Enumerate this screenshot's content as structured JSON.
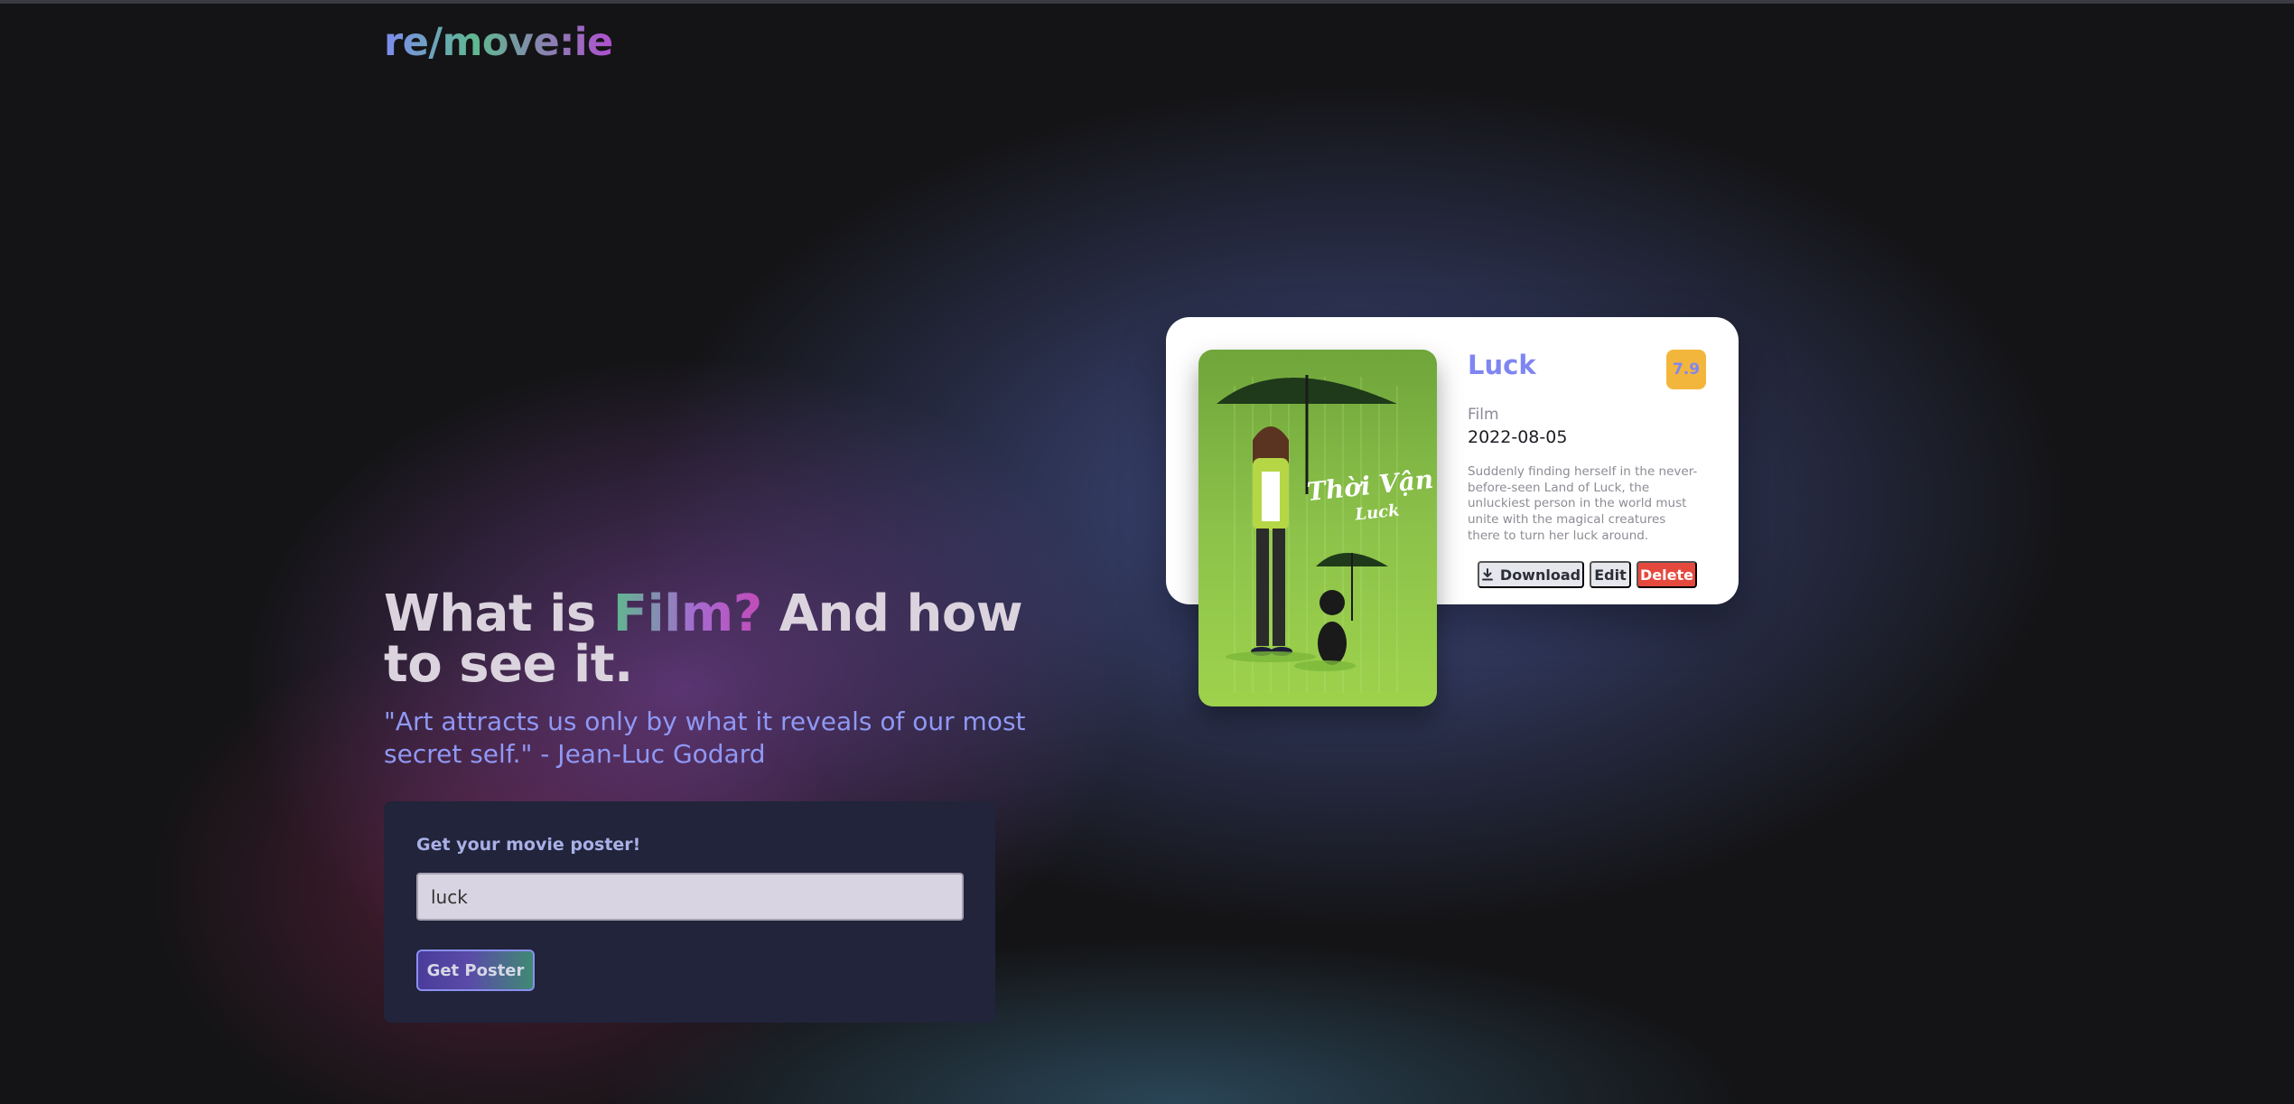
{
  "header": {
    "logo": "re/move:ie"
  },
  "hero": {
    "title_prefix": "What is ",
    "title_accent": "Film?",
    "title_suffix": " And how to see it.",
    "quote": "\"Art attracts us only by what it reveals of our most secret self.\" - Jean-Luc Godard"
  },
  "form": {
    "label": "Get your movie poster!",
    "input_value": "luck",
    "button_label": "Get Poster"
  },
  "movie": {
    "title": "Luck",
    "rating": "7.9",
    "type": "Film",
    "date": "2022-08-05",
    "description": "Suddenly finding herself in the never-before-seen Land of Luck, the unluckiest person in the world must unite with the magical creatures there to turn her luck around.",
    "poster_text_line1": "Thời Vận",
    "poster_text_line2": "Luck"
  },
  "actions": {
    "download_label": "Download",
    "edit_label": "Edit",
    "delete_label": "Delete"
  },
  "icons": {
    "download": "download-icon"
  },
  "colors": {
    "accent_purple": "#7f86f2",
    "rating_bg": "#f3b63c",
    "delete_red": "#e5493e",
    "form_bg": "#21243a",
    "page_bg": "#141416"
  }
}
